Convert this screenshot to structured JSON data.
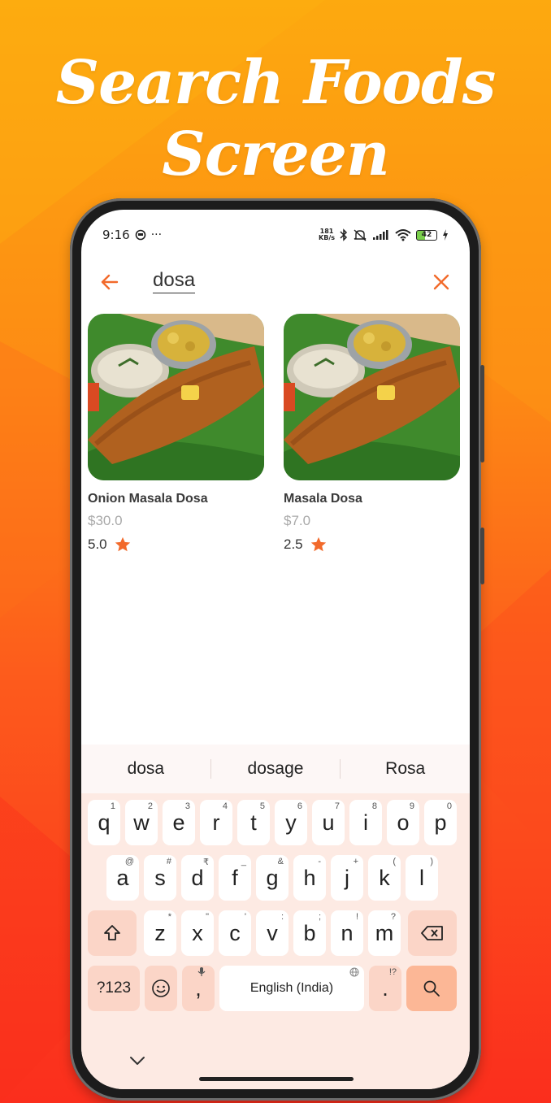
{
  "banner": {
    "title_line1": "Search Foods",
    "title_line2": "Screen"
  },
  "status_bar": {
    "time": "9:16",
    "speed_value": "181",
    "speed_unit": "KB/s",
    "battery": "42"
  },
  "search": {
    "query": "dosa"
  },
  "results": [
    {
      "name": "Onion Masala Dosa",
      "price": "$30.0",
      "rating": "5.0"
    },
    {
      "name": "Masala Dosa",
      "price": "$7.0",
      "rating": "2.5"
    }
  ],
  "keyboard": {
    "suggestions": [
      "dosa",
      "dosage",
      "Rosa"
    ],
    "row1": [
      {
        "k": "q",
        "h": "1"
      },
      {
        "k": "w",
        "h": "2"
      },
      {
        "k": "e",
        "h": "3"
      },
      {
        "k": "r",
        "h": "4"
      },
      {
        "k": "t",
        "h": "5"
      },
      {
        "k": "y",
        "h": "6"
      },
      {
        "k": "u",
        "h": "7"
      },
      {
        "k": "i",
        "h": "8"
      },
      {
        "k": "o",
        "h": "9"
      },
      {
        "k": "p",
        "h": "0"
      }
    ],
    "row2": [
      {
        "k": "a",
        "h": "@"
      },
      {
        "k": "s",
        "h": "#"
      },
      {
        "k": "d",
        "h": "₹"
      },
      {
        "k": "f",
        "h": "_"
      },
      {
        "k": "g",
        "h": "&"
      },
      {
        "k": "h",
        "h": "-"
      },
      {
        "k": "j",
        "h": "+"
      },
      {
        "k": "k",
        "h": "("
      },
      {
        "k": "l",
        "h": ")"
      }
    ],
    "row3": [
      {
        "k": "z",
        "h": "*"
      },
      {
        "k": "x",
        "h": "\""
      },
      {
        "k": "c",
        "h": "'"
      },
      {
        "k": "v",
        "h": ":"
      },
      {
        "k": "b",
        "h": ";"
      },
      {
        "k": "n",
        "h": "!"
      },
      {
        "k": "m",
        "h": "?"
      }
    ],
    "symbols_label": "?123",
    "comma": ",",
    "period": ".",
    "period_hint": "!?",
    "space_label": "English (India)"
  },
  "colors": {
    "accent": "#f26a2b",
    "star": "#f26a2b"
  }
}
